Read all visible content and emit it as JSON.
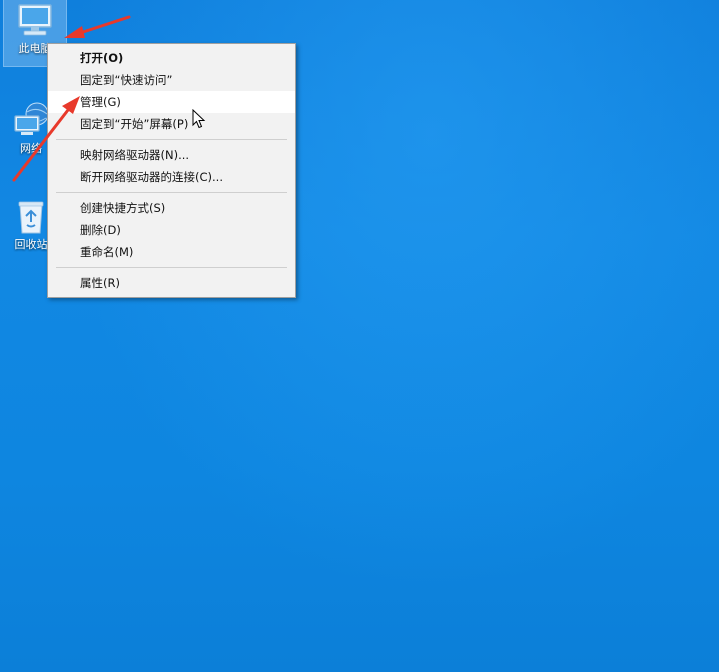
{
  "desktop": {
    "icons": [
      {
        "label": "此电脑",
        "icon": "this-pc-icon",
        "selected": true
      },
      {
        "label": "网络",
        "icon": "network-icon",
        "selected": false
      },
      {
        "label": "回收站",
        "icon": "recycle-bin-icon",
        "selected": false
      }
    ],
    "colors": {
      "background": "#1288e3",
      "arrow": "#e8392b"
    }
  },
  "context_menu": {
    "groups": [
      [
        {
          "label": "打开(O)",
          "bold": true
        },
        {
          "label": "固定到“快速访问”"
        },
        {
          "label": "管理(G)",
          "hover": true
        },
        {
          "label": "固定到“开始”屏幕(P)"
        }
      ],
      [
        {
          "label": "映射网络驱动器(N)..."
        },
        {
          "label": "断开网络驱动器的连接(C)..."
        }
      ],
      [
        {
          "label": "创建快捷方式(S)"
        },
        {
          "label": "删除(D)"
        },
        {
          "label": "重命名(M)"
        }
      ],
      [
        {
          "label": "属性(R)"
        }
      ]
    ]
  }
}
